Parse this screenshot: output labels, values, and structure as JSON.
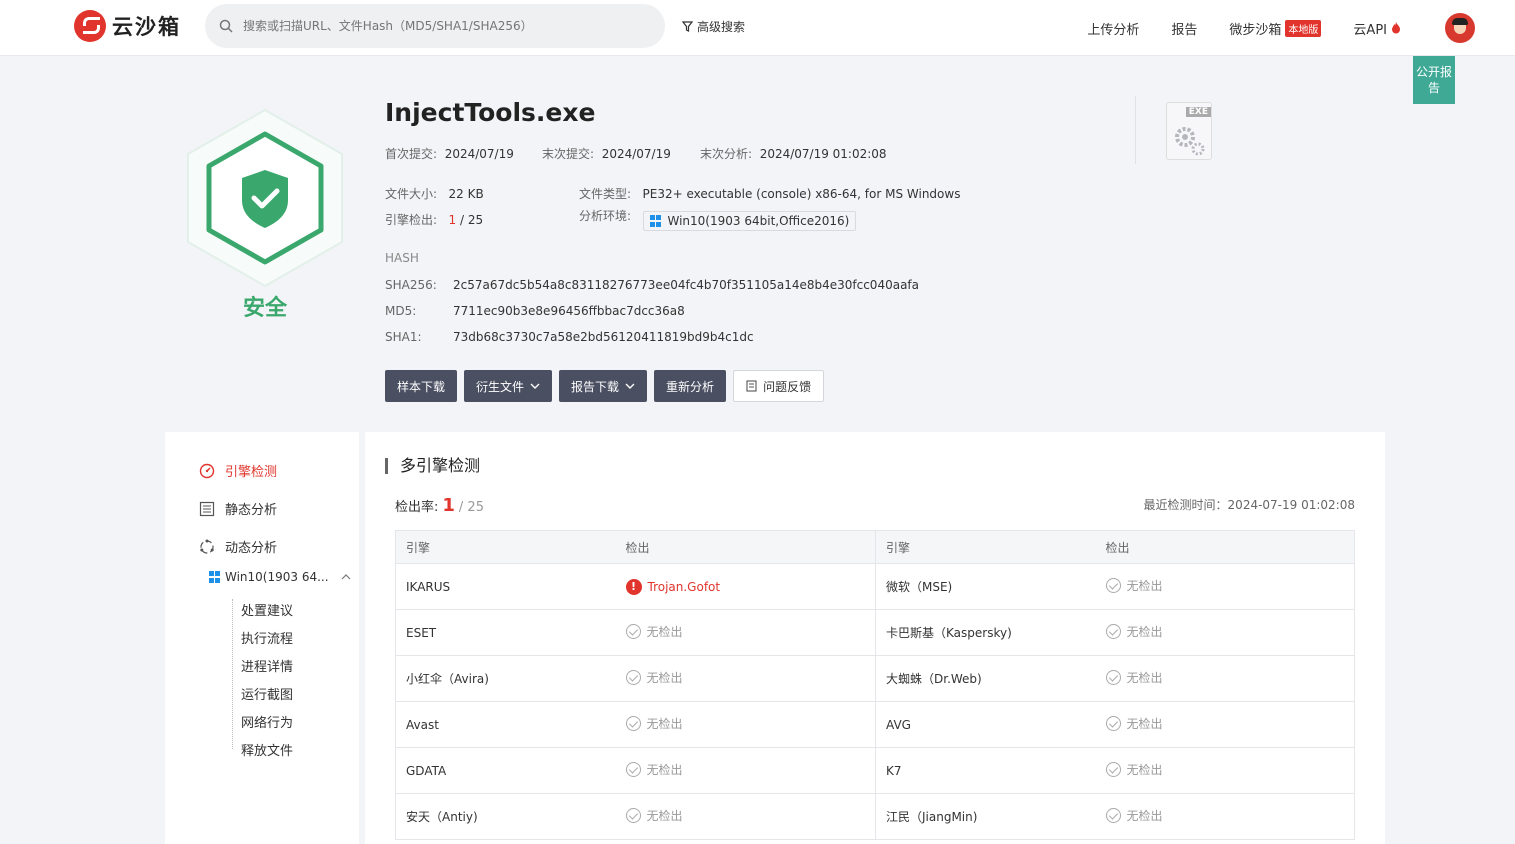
{
  "header": {
    "logo_text": "云沙箱",
    "search_placeholder": "搜索或扫描URL、文件Hash（MD5/SHA1/SHA256）",
    "advanced_search": "高级搜索",
    "nav": {
      "upload": "上传分析",
      "report": "报告",
      "micro_sandbox": "微步沙箱",
      "local_tag": "本地版",
      "cloud_api": "云API"
    }
  },
  "public_report": "公开报告",
  "summary": {
    "verdict": "安全",
    "filename": "InjectTools.exe",
    "first_submit_label": "首次提交:",
    "first_submit": "2024/07/19",
    "last_submit_label": "末次提交:",
    "last_submit": "2024/07/19",
    "last_analysis_label": "末次分析:",
    "last_analysis": "2024/07/19 01:02:08",
    "size_label": "文件大小:",
    "size": "22 KB",
    "type_label": "文件类型:",
    "type": "PE32+ executable (console) x86-64, for MS Windows",
    "engine_label": "引擎检出:",
    "engine_hit": "1",
    "engine_total": " / 25",
    "env_label": "分析环境:",
    "env": "Win10(1903 64bit,Office2016)",
    "file_icon_ext": "EXE",
    "hash_head": "HASH",
    "sha256_label": "SHA256:",
    "sha256": "2c57a67dc5b54a8c83118276773ee04fc4b70f351105a14e8b4e30fcc040aafa",
    "md5_label": "MD5:",
    "md5": "7711ec90b3e8e96456ffbbac7dcc36a8",
    "sha1_label": "SHA1:",
    "sha1": "73db68c3730c7a58e2bd56120411819bd9b4c1dc"
  },
  "actions": {
    "download_sample": "样本下载",
    "derived_files": "衍生文件",
    "download_report": "报告下载",
    "reanalyze": "重新分析",
    "feedback": "问题反馈"
  },
  "sidebar": {
    "engine_detect": "引擎检测",
    "static_analysis": "静态分析",
    "dynamic_analysis": "动态分析",
    "env_short": "Win10(1903 64...",
    "leaves": [
      "处置建议",
      "执行流程",
      "进程详情",
      "运行截图",
      "网络行为",
      "释放文件"
    ]
  },
  "detection": {
    "title": "多引擎检测",
    "rate_label": "检出率:",
    "rate_hit": "1",
    "rate_total": "/ 25",
    "last_time": "最近检测时间：2024-07-19 01:02:08",
    "col_engine": "引擎",
    "col_result": "检出",
    "rows": [
      {
        "e1": "IKARUS",
        "r1": "Trojan.Gofot",
        "e2": "微软（MSE)",
        "r2": "无检出"
      },
      {
        "e1": "ESET",
        "r1": "无检出",
        "e2": "卡巴斯基（Kaspersky)",
        "r2": "无检出"
      },
      {
        "e1": "小红伞（Avira)",
        "r1": "无检出",
        "e2": "大蜘蛛（Dr.Web)",
        "r2": "无检出"
      },
      {
        "e1": "Avast",
        "r1": "无检出",
        "e2": "AVG",
        "r2": "无检出"
      },
      {
        "e1": "GDATA",
        "r1": "无检出",
        "e2": "K7",
        "r2": "无检出"
      },
      {
        "e1": "安天（Antiy)",
        "r1": "无检出",
        "e2": "江民（JiangMin)",
        "r2": "无检出"
      }
    ]
  },
  "colors": {
    "accent": "#e0342c",
    "safe": "#3aa76d",
    "teal": "#3fa996",
    "button": "#4a4f62"
  }
}
